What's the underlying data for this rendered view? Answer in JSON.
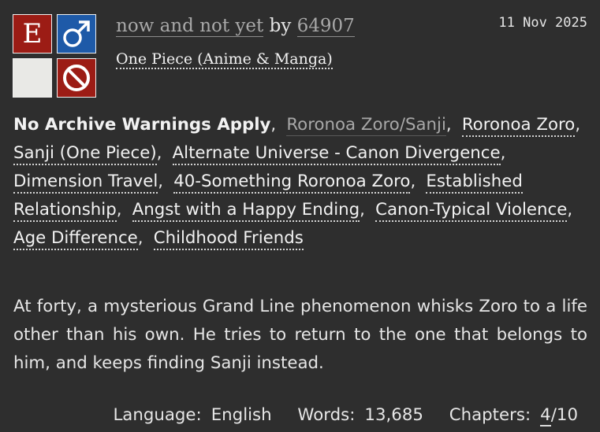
{
  "work": {
    "title": "now and not yet",
    "by": "by",
    "author": "64907",
    "fandom": "One Piece (Anime & Manga)",
    "date": "11 Nov 2025"
  },
  "required_tags": {
    "rating": "E",
    "category_icon": "male-symbol-icon",
    "category_color": "#1e5aa8",
    "rating_color": "#9c1c15",
    "warning_icon": "prohibition-icon"
  },
  "tags": [
    {
      "label": "No Archive Warnings Apply",
      "kind": "warning"
    },
    {
      "label": "Roronoa Zoro/Sanji",
      "kind": "relationship"
    },
    {
      "label": "Roronoa Zoro",
      "kind": "character"
    },
    {
      "label": "Sanji (One Piece)",
      "kind": "character"
    },
    {
      "label": "Alternate Universe - Canon Divergence",
      "kind": "freeform"
    },
    {
      "label": "Dimension Travel",
      "kind": "freeform"
    },
    {
      "label": "40-Something Roronoa Zoro",
      "kind": "freeform"
    },
    {
      "label": "Established Relationship",
      "kind": "freeform"
    },
    {
      "label": "Angst with a Happy Ending",
      "kind": "freeform"
    },
    {
      "label": "Canon-Typical Violence",
      "kind": "freeform"
    },
    {
      "label": "Age Difference",
      "kind": "freeform"
    },
    {
      "label": "Childhood Friends",
      "kind": "freeform"
    }
  ],
  "summary": "At forty, a mysterious Grand Line phenomenon whisks Zoro to a life other than his own. He tries to return to the one that belongs to him, and keeps finding Sanji instead.",
  "stats": {
    "language_label": "Language:",
    "language": "English",
    "words_label": "Words:",
    "words": "13,685",
    "chapters_label": "Chapters:",
    "chapters_posted": "4",
    "chapters_total": "/10"
  }
}
